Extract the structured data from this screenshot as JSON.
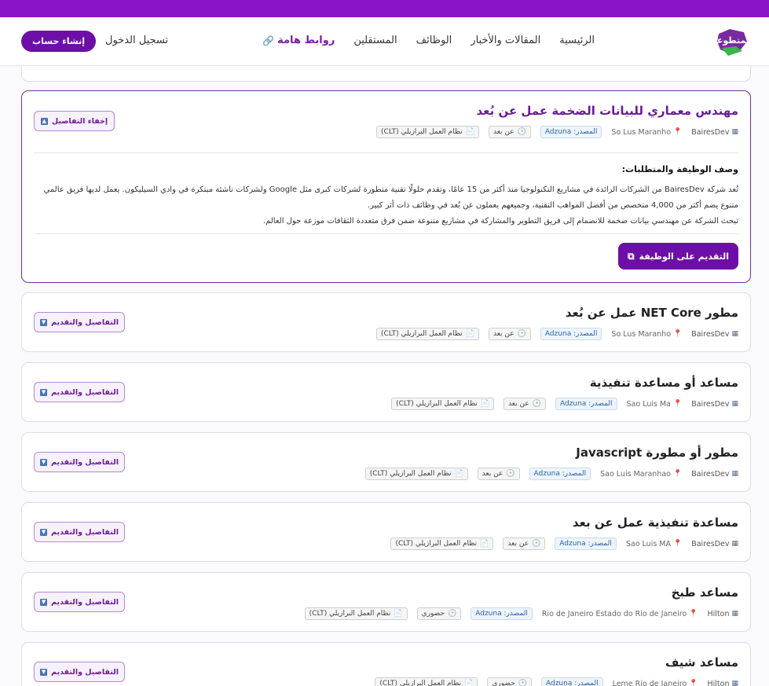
{
  "nav": {
    "logo_text": "المتطوعة",
    "links": [
      "الرئيسية",
      "المقالات والأخبار",
      "الوظائف",
      "المستقلين"
    ],
    "important_links": "روابط هامة",
    "login": "تسجيل الدخول",
    "signup": "إنشاء حساب"
  },
  "jobs": [
    {
      "title": "مهندس معماري للبيانات الضخمة عمل عن بُعد",
      "company": "BairesDev",
      "location": "So Lus Maranho",
      "source": "المصدر: Adzuna",
      "mode": "عن بعد",
      "contract": "نظام العمل البرازيلي (CLT)",
      "button": "إخفاء التفاصيل",
      "expanded": true,
      "desc_heading": "وصف الوظيفة والمتطلبات:",
      "desc_lines": [
        "تُعد شركة BairesDev من الشركات الرائدة في مشاريع التكنولوجيا منذ أكثر من 15 عامًا، وتقدم حلولًا تقنية متطورة لشركات كبرى مثل Google ولشركات ناشئة مبتكرة في وادي السيليكون. يعمل لديها فريق عالمي",
        "متنوع يضم أكثر من 4,000 متخصص من أفضل المواهب التقنية، وجميعهم يعملون عن بُعد في وظائف ذات أثر كبير.",
        "تبحث الشركة عن مهندسي بيانات ضخمة للانضمام إلى فريق التطوير والمشاركة في مشاريع متنوعة ضمن فرق متعددة الثقافات موزعة حول العالم."
      ],
      "apply": "التقديم على الوظيفة"
    },
    {
      "title": "مطور NET Core عمل عن بُعد",
      "company": "BairesDev",
      "location": "So Lus Maranho",
      "source": "المصدر: Adzuna",
      "mode": "عن بعد",
      "contract": "نظام العمل البرازيلي (CLT)",
      "button": "التفاصيل والتقديم"
    },
    {
      "title": "مساعد أو مساعدة تنفيذية",
      "company": "BairesDev",
      "location": "Sao Luis Ma",
      "source": "المصدر: Adzuna",
      "mode": "عن بعد",
      "contract": "نظام العمل البرازيلي (CLT)",
      "button": "التفاصيل والتقديم"
    },
    {
      "title": "مطور أو مطورة Javascript",
      "company": "BairesDev",
      "location": "Sao Luis Maranhao",
      "source": "المصدر: Adzuna",
      "mode": "عن بعد",
      "contract": "نظام العمل البرازيلي (CLT)",
      "button": "التفاصيل والتقديم"
    },
    {
      "title": "مساعدة تنفيذية عمل عن بعد",
      "company": "BairesDev",
      "location": "Sao Luis MA",
      "source": "المصدر: Adzuna",
      "mode": "عن بعد",
      "contract": "نظام العمل البرازيلي (CLT)",
      "button": "التفاصيل والتقديم"
    },
    {
      "title": "مساعد طبخ",
      "company": "Hilton",
      "location": "Rio de Janeiro Estado do Rio de Janeiro",
      "source": "المصدر: Adzuna",
      "mode": "حضوري",
      "contract": "نظام العمل البرازيلي (CLT)",
      "button": "التفاصيل والتقديم"
    },
    {
      "title": "مساعد شيف",
      "company": "Hilton",
      "location": "Leme Rio de Janeiro",
      "source": "المصدر: Adzuna",
      "mode": "حضوري",
      "contract": "نظام العمل البرازيلي (CLT)",
      "button": "التفاصيل والتقديم"
    }
  ]
}
